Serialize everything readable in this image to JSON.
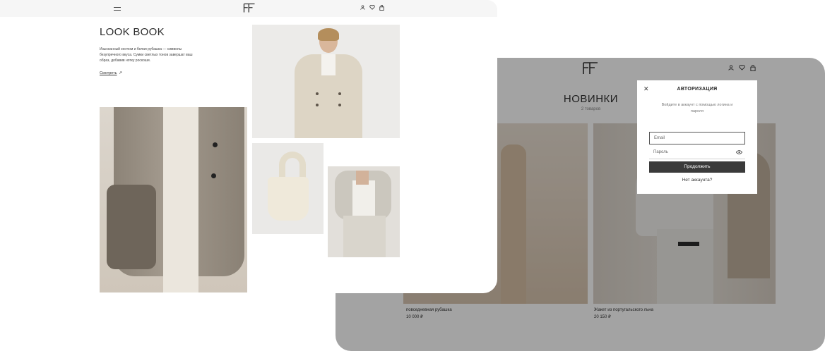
{
  "lookbook": {
    "title": "LOOK BOOK",
    "description": "Изысканный костюм и белая рубашка — символы безупречного вкуса. Сумки светлых тонов завершат ваш образ, добавив нотку роскоши.",
    "link_label": "Смотреть",
    "link_arrow": "↗"
  },
  "catalog": {
    "title": "НОВИНКИ",
    "count": "2 товаров",
    "products": [
      {
        "name": "повседневная рубашка",
        "price": "10 000 ₽"
      },
      {
        "name": "Жакет из португальского льна",
        "price": "20 150 ₽"
      }
    ]
  },
  "auth_modal": {
    "title": "АВТОРИЗАЦИЯ",
    "close": "✕",
    "subtitle": "Войдите в аккаунт с помощью логина и пароля",
    "email_placeholder": "Email",
    "password_placeholder": "Пароль",
    "submit_label": "Продолжить",
    "no_account_link": "Нет аккаунта?"
  },
  "icons": [
    "menu-icon",
    "brand-logo",
    "user-icon",
    "heart-icon",
    "bag-icon",
    "eye-icon",
    "close-icon",
    "arrow-up-right-icon"
  ],
  "colors": {
    "dark_button": "#3a3a3a",
    "overlay": "rgba(0,0,0,0.36)",
    "text": "#2b2b2b"
  }
}
